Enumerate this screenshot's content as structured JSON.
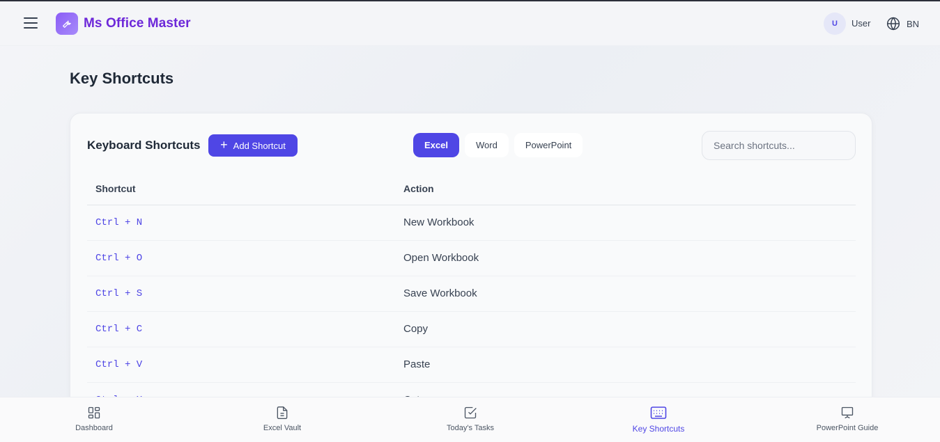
{
  "header": {
    "app_title": "Ms Office Master",
    "user_initial": "U",
    "user_name": "User",
    "language": "BN"
  },
  "page": {
    "title": "Key Shortcuts"
  },
  "card": {
    "title": "Keyboard Shortcuts",
    "add_button": "Add Shortcut",
    "tabs": [
      {
        "label": "Excel",
        "active": true
      },
      {
        "label": "Word",
        "active": false
      },
      {
        "label": "PowerPoint",
        "active": false
      }
    ],
    "search_placeholder": "Search shortcuts...",
    "table": {
      "columns": [
        "Shortcut",
        "Action"
      ],
      "rows": [
        {
          "shortcut": "Ctrl + N",
          "action": "New Workbook"
        },
        {
          "shortcut": "Ctrl + O",
          "action": "Open Workbook"
        },
        {
          "shortcut": "Ctrl + S",
          "action": "Save Workbook"
        },
        {
          "shortcut": "Ctrl + C",
          "action": "Copy"
        },
        {
          "shortcut": "Ctrl + V",
          "action": "Paste"
        },
        {
          "shortcut": "Ctrl + X",
          "action": "Cut"
        }
      ]
    }
  },
  "bottom_nav": [
    {
      "label": "Dashboard",
      "icon": "dashboard-icon",
      "active": false
    },
    {
      "label": "Excel Vault",
      "icon": "file-icon",
      "active": false
    },
    {
      "label": "Today's Tasks",
      "icon": "checkbox-icon",
      "active": false
    },
    {
      "label": "Key Shortcuts",
      "icon": "keyboard-icon",
      "active": true
    },
    {
      "label": "PowerPoint Guide",
      "icon": "presentation-icon",
      "active": false
    }
  ],
  "colors": {
    "accent": "#4f46e5",
    "brand": "#6d28d9"
  }
}
